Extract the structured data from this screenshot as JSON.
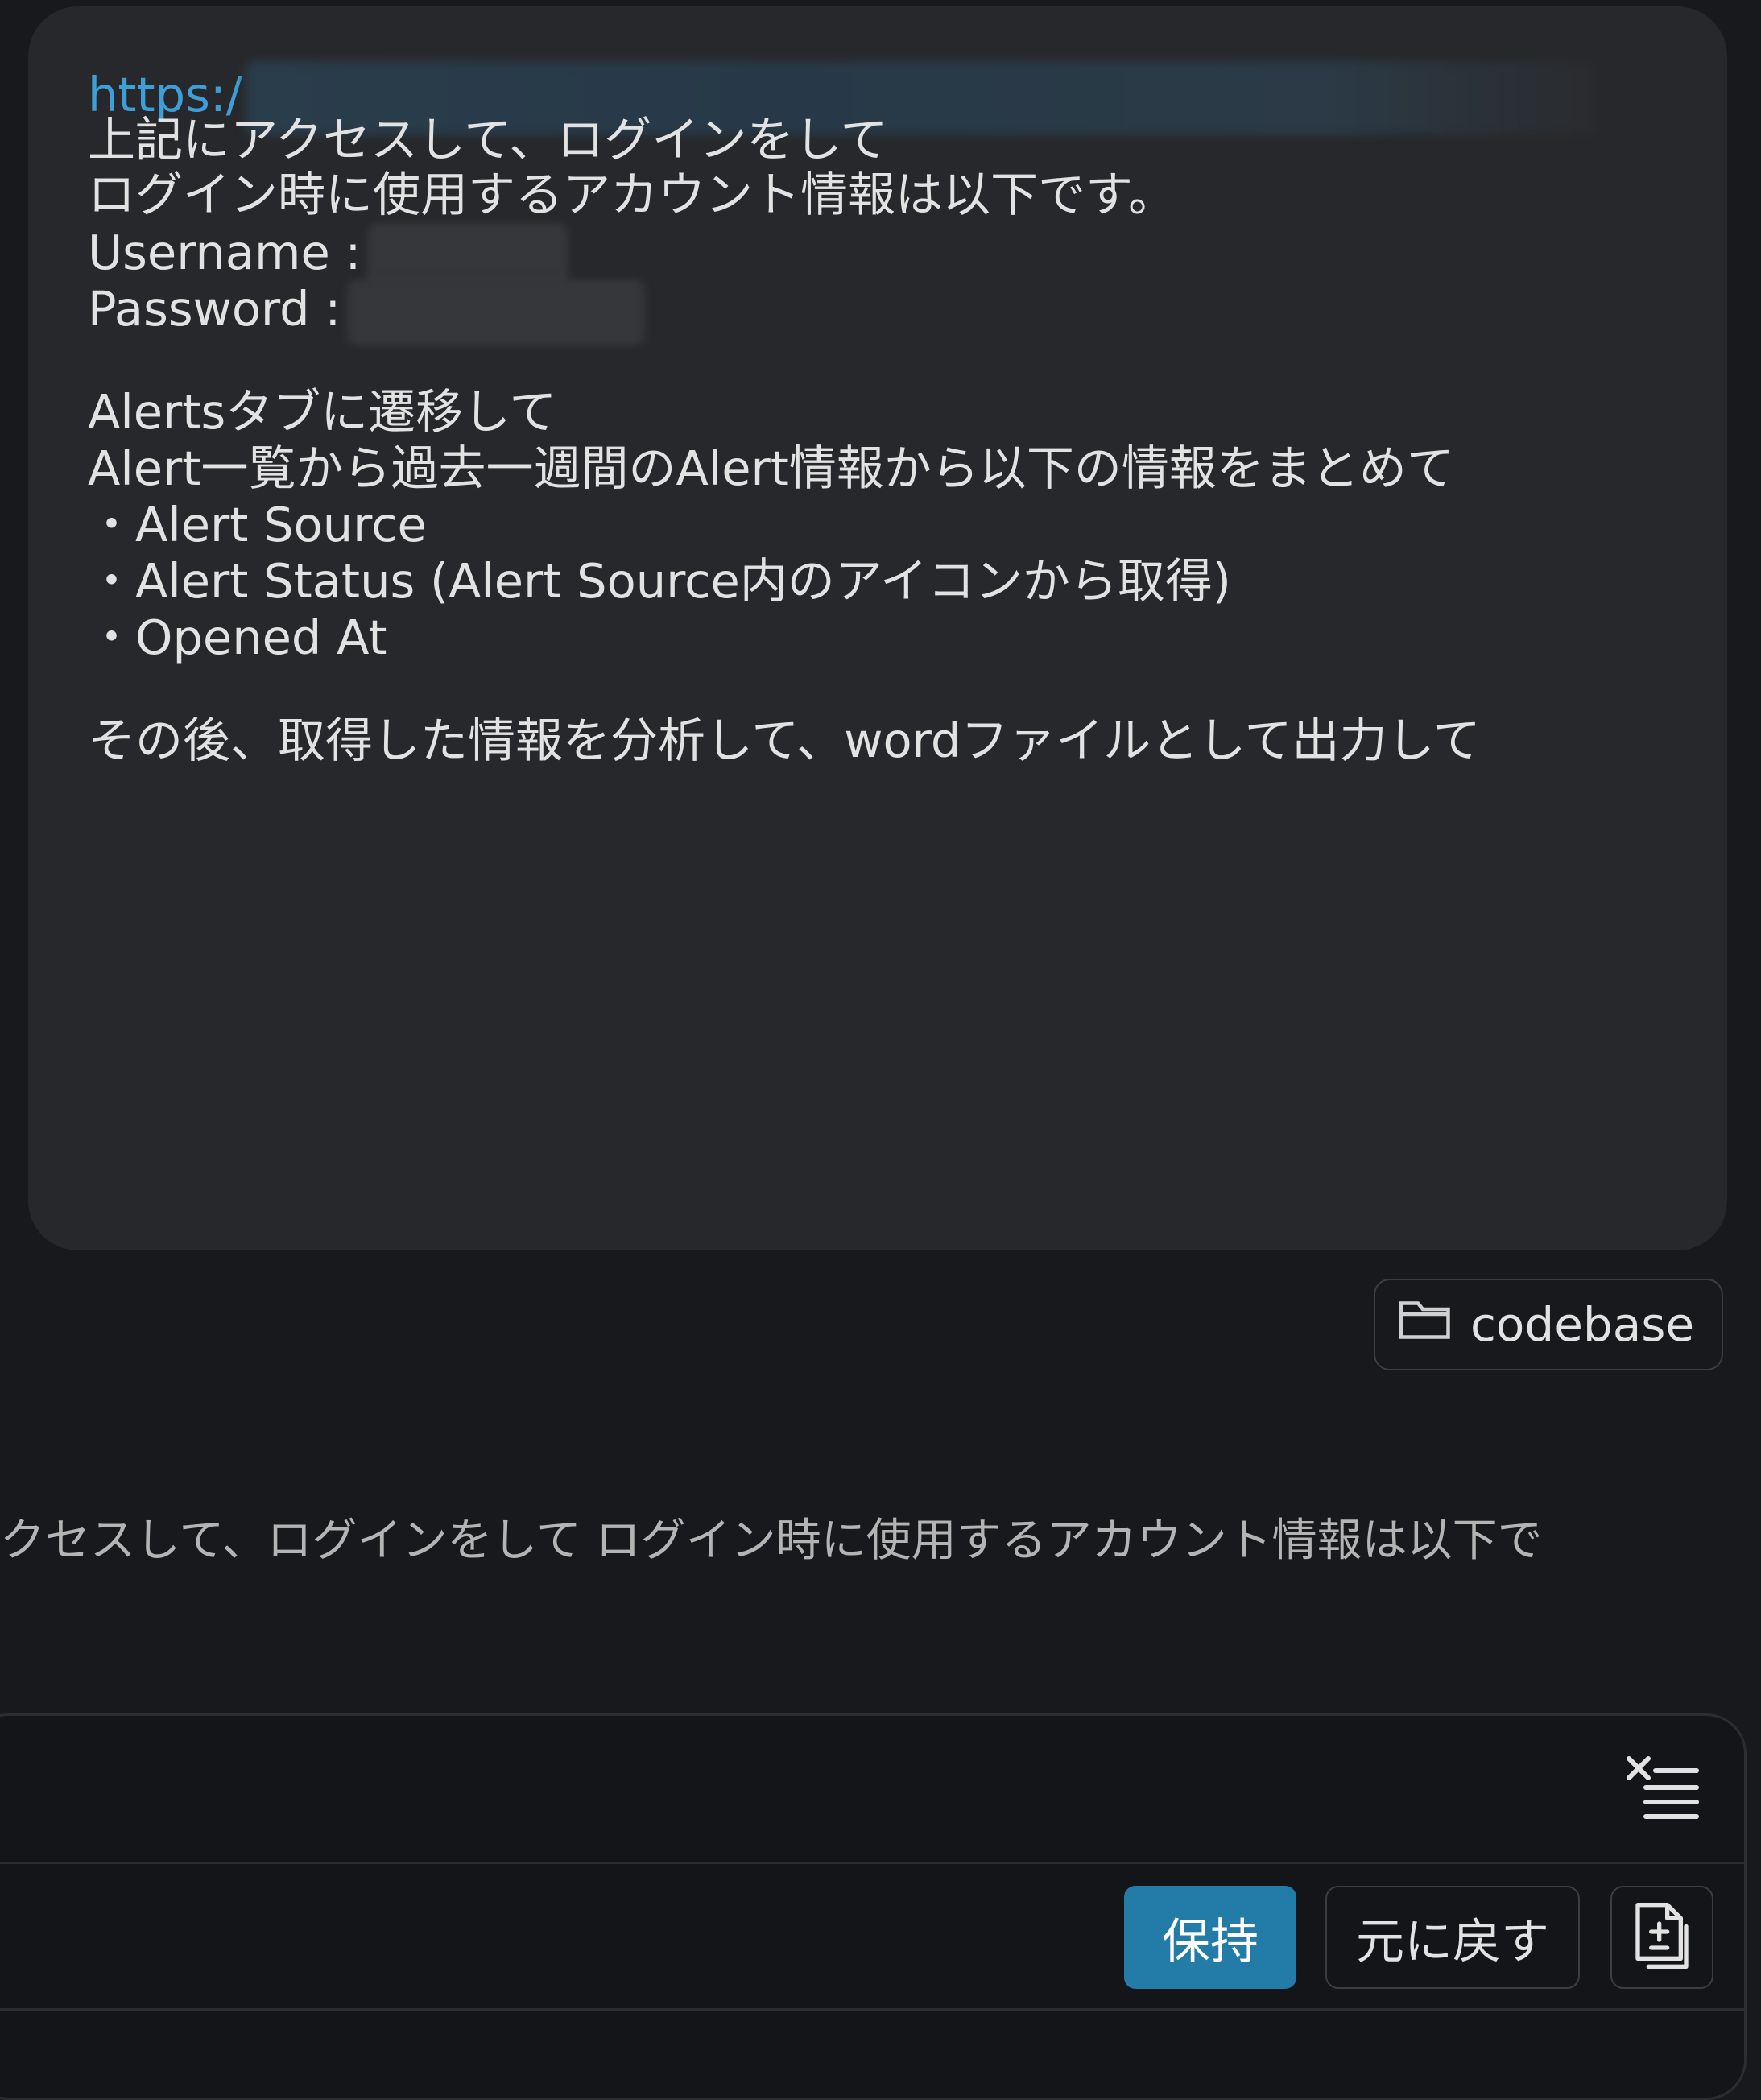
{
  "message": {
    "url_prefix": "https:/",
    "lines": [
      "上記にアクセスして、ログインをして",
      "ログイン時に使用するアカウント情報は以下です。",
      "Alertsタブに遷移して",
      "Alert一覧から過去一週間のAlert情報から以下の情報をまとめて",
      "・Alert Source",
      "・Alert Status (Alert Source内のアイコンから取得)",
      "・Opened At",
      "その後、取得した情報を分析して、wordファイルとして出力して"
    ],
    "username_label": "Username :",
    "password_label": "Password :"
  },
  "context_chip": {
    "icon": "folder-icon",
    "label": "codebase"
  },
  "preview_text": "クセスして、ログインをして ログイン時に使用するアカウント情報は以下で",
  "actions": {
    "clear_icon": "clear-list-icon",
    "keep_label": "保持",
    "undo_label": "元に戻す",
    "diff_icon": "file-diff-icon"
  },
  "colors": {
    "accent": "#237ca8",
    "link": "#3d9fd6",
    "bubble": "#27282b",
    "background": "#18191c"
  }
}
